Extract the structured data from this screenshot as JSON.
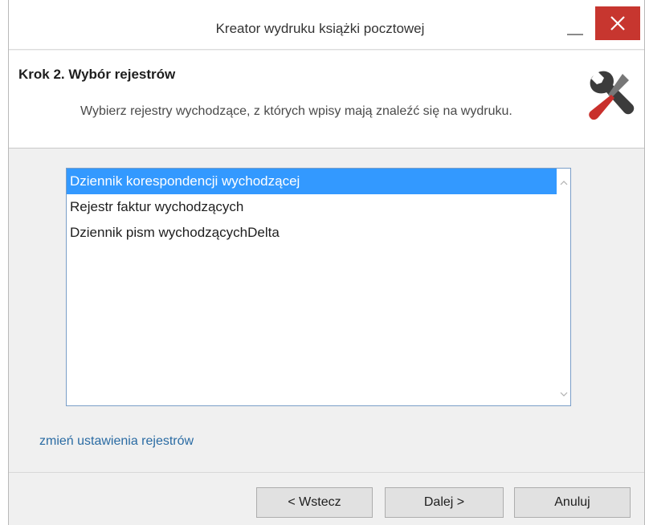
{
  "window": {
    "title": "Kreator wydruku książki pocztowej"
  },
  "header": {
    "step_title": "Krok 2. Wybór rejestrów",
    "description": "Wybierz rejestry wychodzące, z których wpisy mają znaleźć się na wydruku."
  },
  "registers": {
    "items": [
      {
        "label": "Dziennik korespondencji wychodzącej",
        "selected": true
      },
      {
        "label": "Rejestr faktur wychodzących",
        "selected": false
      },
      {
        "label": "Dziennik pism wychodzącychDelta",
        "selected": false
      }
    ]
  },
  "link": {
    "change_settings": "zmień ustawienia rejestrów"
  },
  "buttons": {
    "back": "< Wstecz",
    "next": "Dalej >",
    "cancel": "Anuluj"
  },
  "colors": {
    "close": "#c7362f",
    "selection": "#3399ff",
    "link": "#2a6ba3",
    "tool_handle": "#c9302c",
    "tool_wrench": "#3c3c3c"
  },
  "icons": {
    "header": "tools-icon",
    "close": "close-icon",
    "minimize": "minimize-icon"
  }
}
